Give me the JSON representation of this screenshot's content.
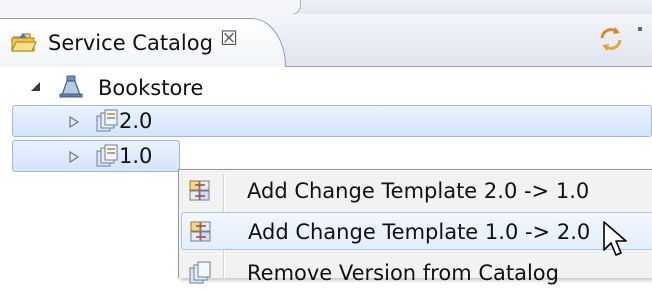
{
  "view": {
    "title": "Service Catalog",
    "close_glyph": "☒",
    "tab_icon": "catalog-folder-icon",
    "toolbar_icon": "sync-icon"
  },
  "tree": {
    "root": {
      "label": "Bookstore",
      "icon": "server-icon",
      "expanded": true
    },
    "versions": [
      {
        "label": "2.0",
        "icon": "versions-icon",
        "selected": true
      },
      {
        "label": "1.0",
        "icon": "versions-icon",
        "selected": true
      }
    ]
  },
  "context_menu": {
    "items": [
      {
        "label": "Add Change Template 2.0 -> 1.0",
        "icon": "change-template-icon",
        "hovered": false
      },
      {
        "label": "Add Change Template 1.0 -> 2.0",
        "icon": "change-template-icon",
        "hovered": true
      },
      {
        "label": "Remove Version from Catalog",
        "icon": "remove-version-icon",
        "hovered": false
      }
    ]
  },
  "colors": {
    "selection_fill": "#d4e4fa",
    "selection_border": "#9bb9e4",
    "menu_background": "#f2f2f2",
    "menu_hover_border": "#a8c8ef"
  }
}
